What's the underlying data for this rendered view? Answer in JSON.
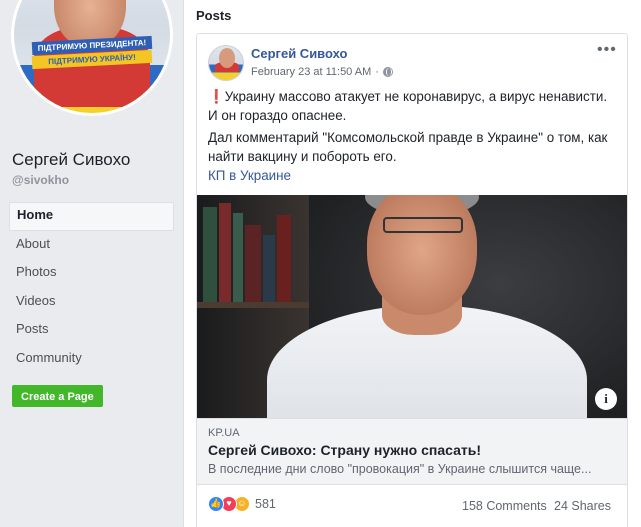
{
  "sidebar": {
    "avatar_banner_line1": "ПІДТРИМУЮ ПРЕЗИДЕНТА!",
    "avatar_banner_line2": "ПІДТРИМУЮ УКРАЇНУ!",
    "page_name": "Сергей Сивохо",
    "page_handle": "@sivokho",
    "nav": [
      {
        "label": "Home",
        "active": true
      },
      {
        "label": "About"
      },
      {
        "label": "Photos"
      },
      {
        "label": "Videos"
      },
      {
        "label": "Posts"
      },
      {
        "label": "Community"
      }
    ],
    "create_page_label": "Create a Page"
  },
  "main": {
    "section_title": "Posts",
    "post": {
      "author": "Сергей Сивохо",
      "timestamp": "February 23 at 11:50 AM",
      "meta_separator": "·",
      "more_icon": "more-horizontal-icon",
      "exclaim": "❗",
      "text_p1": "Украину массово атакует не коронавирус, а вирус ненависти. И он гораздо опаснее.",
      "text_p2": "Дал комментарий \"Комсомольской правде в Украине\" о том, как найти вакцину и побороть его.",
      "link_text": "КП в Украине",
      "preview": {
        "domain": "KP.UA",
        "title": "Сергей Сивохо: Страну нужно спасать!",
        "description": "В последние дни слово \"провокация\" в Украине слышится чаще..."
      },
      "reactions": {
        "icons": [
          "like-icon",
          "love-icon",
          "haha-icon"
        ],
        "count": "581"
      },
      "comments": "158 Comments",
      "shares": "24 Shares"
    }
  },
  "colors": {
    "link_blue": "#365899",
    "create_button_green": "#42b72a",
    "page_bg": "#e9ebee"
  }
}
